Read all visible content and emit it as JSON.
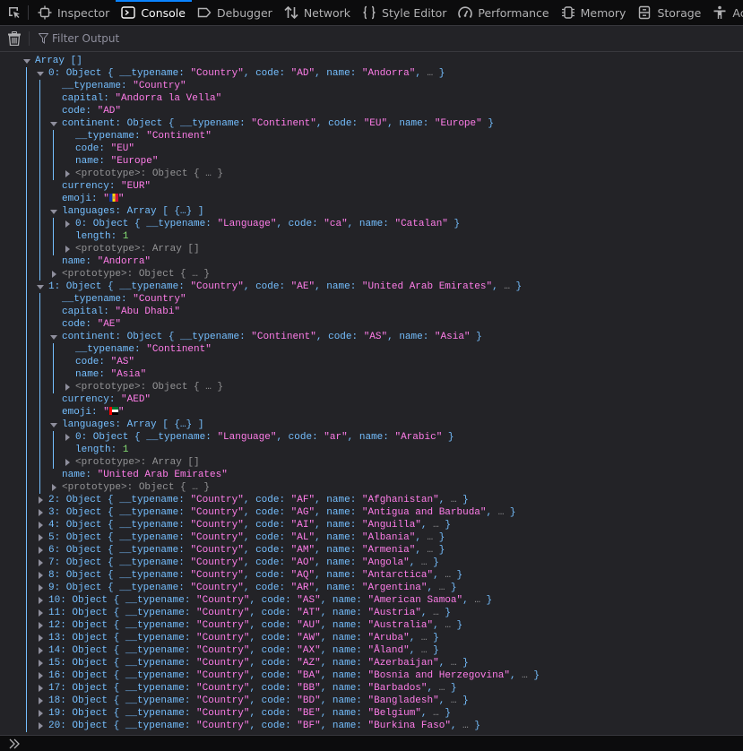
{
  "toolbox": {
    "picker_label": "Pick an element from the page",
    "tabs": [
      {
        "label": "Inspector",
        "icon": "inspector-icon",
        "selected": false
      },
      {
        "label": "Console",
        "icon": "console-icon",
        "selected": true
      },
      {
        "label": "Debugger",
        "icon": "debugger-icon",
        "selected": false
      },
      {
        "label": "Network",
        "icon": "network-icon",
        "selected": false
      },
      {
        "label": "Style Editor",
        "icon": "style-editor-icon",
        "selected": false
      },
      {
        "label": "Performance",
        "icon": "performance-icon",
        "selected": false
      },
      {
        "label": "Memory",
        "icon": "memory-icon",
        "selected": false
      },
      {
        "label": "Storage",
        "icon": "storage-icon",
        "selected": false
      },
      {
        "label": "Accessibility",
        "icon": "accessibility-icon",
        "selected": false
      }
    ],
    "accent_color": "#0a84ff"
  },
  "console_toolbar": {
    "clear_icon": "trash-icon",
    "filter_placeholder": "Filter Output",
    "filter_value": ""
  },
  "output": {
    "root_label": "Array []",
    "expanded_items": [
      {
        "index": 0,
        "preview": {
          "typename": "Country",
          "code": "AD",
          "name": "Andorra"
        },
        "typename": "Country",
        "capital": "Andorra la Vella",
        "code": "AD",
        "continent": {
          "typename": "Continent",
          "code": "EU",
          "name": "Europe"
        },
        "currency": "EUR",
        "emoji_flag": "AD",
        "languages": {
          "summary": "Array [ {…} ]",
          "items": [
            {
              "index": 0,
              "typename": "Language",
              "code": "ca",
              "name": "Catalan"
            }
          ],
          "length": 1
        },
        "name": "Andorra"
      },
      {
        "index": 1,
        "preview": {
          "typename": "Country",
          "code": "AE",
          "name": "United Arab Emirates"
        },
        "typename": "Country",
        "capital": "Abu Dhabi",
        "code": "AE",
        "continent": {
          "typename": "Continent",
          "code": "AS",
          "name": "Asia"
        },
        "currency": "AED",
        "emoji_flag": "AE",
        "languages": {
          "summary": "Array [ {…} ]",
          "items": [
            {
              "index": 0,
              "typename": "Language",
              "code": "ar",
              "name": "Arabic"
            }
          ],
          "length": 1
        },
        "name": "United Arab Emirates"
      }
    ],
    "collapsed_items": [
      {
        "index": 2,
        "typename": "Country",
        "code": "AF",
        "name": "Afghanistan"
      },
      {
        "index": 3,
        "typename": "Country",
        "code": "AG",
        "name": "Antigua and Barbuda"
      },
      {
        "index": 4,
        "typename": "Country",
        "code": "AI",
        "name": "Anguilla"
      },
      {
        "index": 5,
        "typename": "Country",
        "code": "AL",
        "name": "Albania"
      },
      {
        "index": 6,
        "typename": "Country",
        "code": "AM",
        "name": "Armenia"
      },
      {
        "index": 7,
        "typename": "Country",
        "code": "AO",
        "name": "Angola"
      },
      {
        "index": 8,
        "typename": "Country",
        "code": "AQ",
        "name": "Antarctica"
      },
      {
        "index": 9,
        "typename": "Country",
        "code": "AR",
        "name": "Argentina"
      },
      {
        "index": 10,
        "typename": "Country",
        "code": "AS",
        "name": "American Samoa"
      },
      {
        "index": 11,
        "typename": "Country",
        "code": "AT",
        "name": "Austria"
      },
      {
        "index": 12,
        "typename": "Country",
        "code": "AU",
        "name": "Australia"
      },
      {
        "index": 13,
        "typename": "Country",
        "code": "AW",
        "name": "Aruba"
      },
      {
        "index": 14,
        "typename": "Country",
        "code": "AX",
        "name": "Åland"
      },
      {
        "index": 15,
        "typename": "Country",
        "code": "AZ",
        "name": "Azerbaijan"
      },
      {
        "index": 16,
        "typename": "Country",
        "code": "BA",
        "name": "Bosnia and Herzegovina"
      },
      {
        "index": 17,
        "typename": "Country",
        "code": "BB",
        "name": "Barbados"
      },
      {
        "index": 18,
        "typename": "Country",
        "code": "BD",
        "name": "Bangladesh"
      },
      {
        "index": 19,
        "typename": "Country",
        "code": "BE",
        "name": "Belgium"
      },
      {
        "index": 20,
        "typename": "Country",
        "code": "BF",
        "name": "Burkina Faso"
      }
    ],
    "prototype_object": "<prototype>: Object { … }",
    "prototype_array": "<prototype>: Array []"
  },
  "jsterm": {
    "prompt_icon": "double-chevron-right-icon",
    "value": ""
  },
  "colors": {
    "key": "#75bfff",
    "string": "#ff7de9",
    "number": "#86de74",
    "dim": "#939395",
    "background": "#232327",
    "toolbar_bg": "#0c0c0d"
  }
}
